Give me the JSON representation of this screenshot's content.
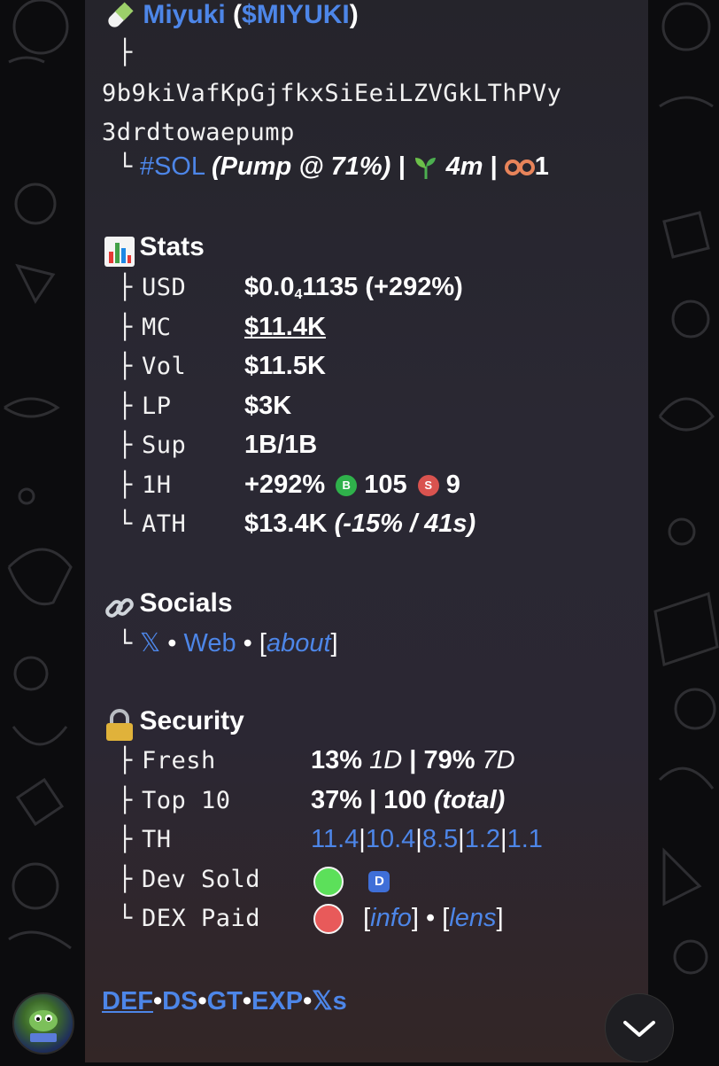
{
  "token": {
    "name": "Miyuki",
    "ticker_open": "(",
    "ticker": "$MIYUKI",
    "ticker_close": ")",
    "address_branch": "├",
    "address_line1": "9b9kiVafKpGjfkxSiEeiLZVGkLThPVy",
    "address_line2": "3drdtowaepump",
    "chain_branch": "└",
    "chain": "#SOL",
    "pump_info": "(Pump @ 71%) |",
    "age": "4m",
    "age_sep": "|",
    "count": "1",
    "icons": {
      "pill": "pill-icon",
      "sprout": "sprout-icon",
      "glasses": "glasses-icon"
    }
  },
  "stats": {
    "title": "Stats",
    "icon": "bar-chart-icon",
    "rows": [
      {
        "branch": "├",
        "label": "USD"
      },
      {
        "branch": "├",
        "label": "MC",
        "value": "$11.4K"
      },
      {
        "branch": "├",
        "label": "Vol",
        "value": "$11.5K"
      },
      {
        "branch": "├",
        "label": "LP",
        "value": "$3K"
      },
      {
        "branch": "├",
        "label": "Sup",
        "value": "1B/1B"
      },
      {
        "branch": "├",
        "label": "1H"
      },
      {
        "branch": "└",
        "label": "ATH"
      }
    ],
    "usd_main": "$0.0",
    "usd_sub": "4",
    "usd_rest": "1135",
    "usd_change": "(+292%)",
    "h1_change": "+292%",
    "buys_badge": "B",
    "buys": "105",
    "sells_badge": "S",
    "sells": "9",
    "ath_value": "$13.4K",
    "ath_detail": "(-15% / 41s)",
    "colors": {
      "buy": "#2fb14b",
      "sell": "#d9534f"
    }
  },
  "socials": {
    "title": "Socials",
    "icon": "link-icon",
    "branch": "└",
    "x": "𝕏",
    "sep": "•",
    "web": "Web",
    "about_open": "[",
    "about": "about",
    "about_close": "]"
  },
  "security": {
    "title": "Security",
    "icon": "lock-icon",
    "rows": [
      {
        "branch": "├",
        "label": "Fresh"
      },
      {
        "branch": "├",
        "label": "Top 10"
      },
      {
        "branch": "├",
        "label": "TH"
      },
      {
        "branch": "├",
        "label": "Dev Sold"
      },
      {
        "branch": "└",
        "label": "DEX Paid"
      }
    ],
    "fresh_1": "13%",
    "fresh_1_period": "1D",
    "fresh_sep": "|",
    "fresh_2": "79%",
    "fresh_2_period": "7D",
    "top10_pct": "37%",
    "top10_sep": "|",
    "top10_count": "100",
    "top10_note": "(total)",
    "th_values": [
      "11.4",
      "10.4",
      "8.5",
      "1.2",
      "1.1"
    ],
    "th_sep": "|",
    "dev_badge": "D",
    "dex_info_open": "[",
    "dex_info": "info",
    "dex_info_close": "]",
    "dex_sep": "•",
    "dex_lens_open": "[",
    "dex_lens": "lens",
    "dex_lens_close": "]",
    "colors": {
      "dev_sold": "#5ce05a",
      "dex_paid": "#e85a5a",
      "badge": "#3f6fd8"
    }
  },
  "footer": {
    "links": [
      "DEF",
      "DS",
      "GT",
      "EXP",
      "𝕏s"
    ],
    "sep": "•"
  },
  "colors": {
    "link": "#4d86e8",
    "bubble": "#28262f"
  }
}
